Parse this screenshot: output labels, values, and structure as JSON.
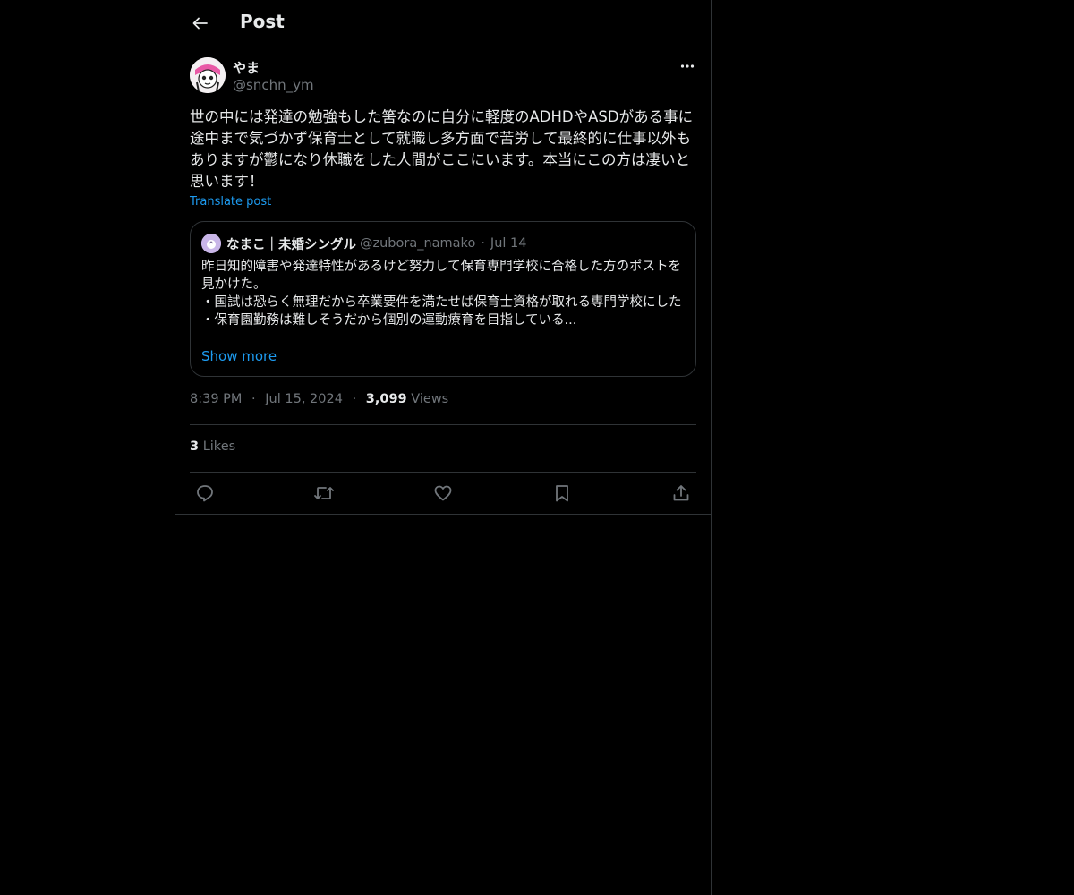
{
  "header": {
    "title": "Post",
    "back_icon": "arrow-left-icon"
  },
  "author": {
    "name": "やま",
    "handle": "@snchn_ym",
    "more_icon": "more-horizontal-icon"
  },
  "post": {
    "text": "世の中には発達の勉強もした筈なのに自分に軽度のADHDやASDがある事に途中まで気づかず保育士として就職し多方面で苦労して最終的に仕事以外もありますが鬱になり休職をした人間がここにいます。本当にこの方は凄いと思います！",
    "translate_label": "Translate post"
  },
  "quote": {
    "name": "なまこ｜未婚シングル",
    "handle": "@zubora_namako",
    "separator": "·",
    "date": "Jul 14",
    "text": "昨日知的障害や発達特性があるけど努力して保育専門学校に合格した方のポストを見かけた。\n・国試は恐らく無理だから卒業要件を満たせば保育士資格が取れる専門学校にした\n・保育園勤務は難しそうだから個別の運動療育を目指している...",
    "show_more": "Show more"
  },
  "meta": {
    "time": "8:39 PM",
    "separator": "·",
    "date": "Jul 15, 2024",
    "views_count": "3,099",
    "views_label": "Views"
  },
  "likes": {
    "count": "3",
    "label": "Likes"
  },
  "actions": [
    "reply-icon",
    "repost-icon",
    "like-icon",
    "bookmark-icon",
    "share-icon"
  ],
  "colors": {
    "background": "#000000",
    "text": "#e7e9ea",
    "secondary": "#71767b",
    "link": "#1d9bf0",
    "border": "#2f3336"
  }
}
